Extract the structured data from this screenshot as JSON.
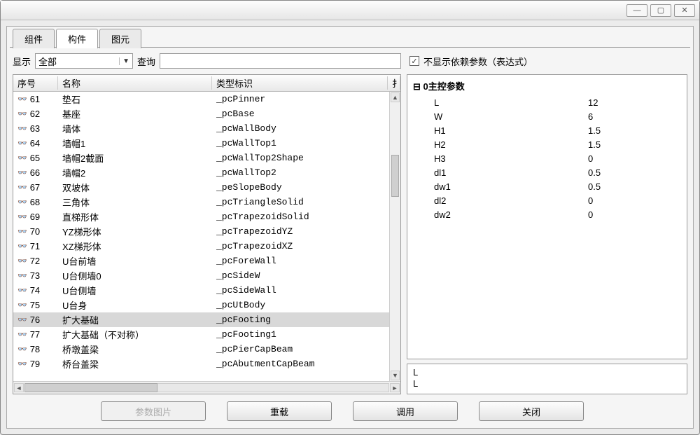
{
  "tabs": {
    "group": "组件",
    "component": "构件",
    "primitive": "图元"
  },
  "filter": {
    "show_label": "显示",
    "show_value": "全部",
    "query_label": "查询",
    "query_value": ""
  },
  "checkbox": {
    "checked_glyph": "✓",
    "label": "不显示依赖参数（表达式）"
  },
  "table": {
    "headers": {
      "seq": "序号",
      "name": "名称",
      "type": "类型标识",
      "extra": "扌"
    },
    "rows": [
      {
        "seq": "61",
        "name": "垫石",
        "type": "_pcPinner"
      },
      {
        "seq": "62",
        "name": "基座",
        "type": "_pcBase"
      },
      {
        "seq": "63",
        "name": "墙体",
        "type": "_pcWallBody"
      },
      {
        "seq": "64",
        "name": "墙帽1",
        "type": "_pcWallTop1"
      },
      {
        "seq": "65",
        "name": "墙帽2截面",
        "type": "_pcWallTop2Shape"
      },
      {
        "seq": "66",
        "name": "墙帽2",
        "type": "_pcWallTop2"
      },
      {
        "seq": "67",
        "name": "双坡体",
        "type": "_peSlopeBody"
      },
      {
        "seq": "68",
        "name": "三角体",
        "type": "_pcTriangleSolid"
      },
      {
        "seq": "69",
        "name": "直梯形体",
        "type": "_pcTrapezoidSolid"
      },
      {
        "seq": "70",
        "name": "YZ梯形体",
        "type": "_pcTrapezoidYZ"
      },
      {
        "seq": "71",
        "name": "XZ梯形体",
        "type": "_pcTrapezoidXZ"
      },
      {
        "seq": "72",
        "name": "U台前墙",
        "type": "_pcForeWall"
      },
      {
        "seq": "73",
        "name": "U台侧墙0",
        "type": "_pcSideW"
      },
      {
        "seq": "74",
        "name": "U台侧墙",
        "type": "_pcSideWall"
      },
      {
        "seq": "75",
        "name": "U台身",
        "type": "_pcUtBody"
      },
      {
        "seq": "76",
        "name": "扩大基础",
        "type": "_pcFooting",
        "selected": true
      },
      {
        "seq": "77",
        "name": "扩大基础（不对称）",
        "type": "_pcFooting1"
      },
      {
        "seq": "78",
        "name": "桥墩盖梁",
        "type": "_pcPierCapBeam"
      },
      {
        "seq": "79",
        "name": "桥台盖梁",
        "type": "_pcAbutmentCapBeam"
      }
    ]
  },
  "params": {
    "group_label": "0主控参数",
    "collapse_glyph": "⊟",
    "items": [
      {
        "key": "L",
        "value": "12"
      },
      {
        "key": "W",
        "value": "6"
      },
      {
        "key": "H1",
        "value": "1.5"
      },
      {
        "key": "H2",
        "value": "1.5"
      },
      {
        "key": "H3",
        "value": "0"
      },
      {
        "key": "dl1",
        "value": "0.5"
      },
      {
        "key": "dw1",
        "value": "0.5"
      },
      {
        "key": "dl2",
        "value": "0"
      },
      {
        "key": "dw2",
        "value": "0"
      }
    ]
  },
  "preview": {
    "line1": "L",
    "line2": "L"
  },
  "buttons": {
    "param_image": "参数图片",
    "reload": "重载",
    "invoke": "调用",
    "close": "关闭"
  },
  "glyphs": {
    "glasses": "👓"
  }
}
